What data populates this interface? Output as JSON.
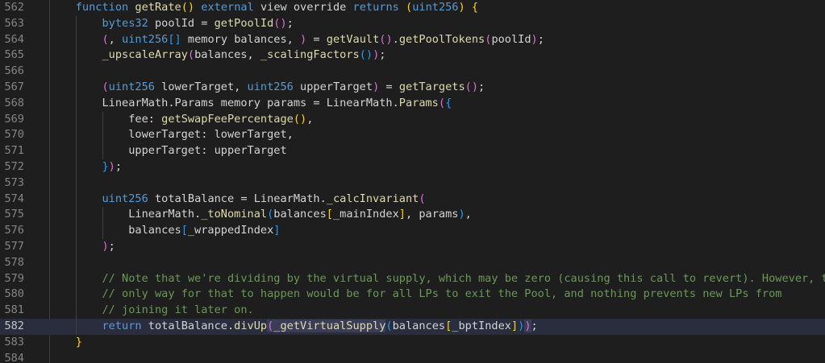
{
  "editor": {
    "lines": [
      {
        "num": "562",
        "tokens": [
          {
            "t": "    "
          },
          {
            "t": "function",
            "c": "kw"
          },
          {
            "t": " "
          },
          {
            "t": "getRate",
            "c": "fn"
          },
          {
            "t": "()",
            "c": "b1"
          },
          {
            "t": " "
          },
          {
            "t": "external",
            "c": "kw"
          },
          {
            "t": " view override "
          },
          {
            "t": "returns",
            "c": "kw"
          },
          {
            "t": " "
          },
          {
            "t": "(",
            "c": "b1"
          },
          {
            "t": "uint256",
            "c": "kw"
          },
          {
            "t": ")",
            "c": "b1"
          },
          {
            "t": " "
          },
          {
            "t": "{",
            "c": "b1"
          }
        ]
      },
      {
        "num": "563",
        "tokens": [
          {
            "t": "        "
          },
          {
            "t": "bytes32",
            "c": "kw"
          },
          {
            "t": " poolId = "
          },
          {
            "t": "getPoolId",
            "c": "fn"
          },
          {
            "t": "()",
            "c": "b2"
          },
          {
            "t": ";"
          }
        ]
      },
      {
        "num": "564",
        "tokens": [
          {
            "t": "        "
          },
          {
            "t": "(",
            "c": "b2"
          },
          {
            "t": ", "
          },
          {
            "t": "uint256",
            "c": "kw"
          },
          {
            "t": "[]",
            "c": "b3"
          },
          {
            "t": " memory balances, "
          },
          {
            "t": ")",
            "c": "b2"
          },
          {
            "t": " = "
          },
          {
            "t": "getVault",
            "c": "fn"
          },
          {
            "t": "()",
            "c": "b2"
          },
          {
            "t": "."
          },
          {
            "t": "getPoolTokens",
            "c": "fn"
          },
          {
            "t": "(",
            "c": "b2"
          },
          {
            "t": "poolId"
          },
          {
            "t": ")",
            "c": "b2"
          },
          {
            "t": ";"
          }
        ]
      },
      {
        "num": "565",
        "tokens": [
          {
            "t": "        "
          },
          {
            "t": "_upscaleArray",
            "c": "fn"
          },
          {
            "t": "(",
            "c": "b2"
          },
          {
            "t": "balances, "
          },
          {
            "t": "_scalingFactors",
            "c": "fn"
          },
          {
            "t": "()",
            "c": "b3"
          },
          {
            "t": ")",
            "c": "b2"
          },
          {
            "t": ";"
          }
        ]
      },
      {
        "num": "566",
        "tokens": []
      },
      {
        "num": "567",
        "tokens": [
          {
            "t": "        "
          },
          {
            "t": "(",
            "c": "b2"
          },
          {
            "t": "uint256",
            "c": "kw"
          },
          {
            "t": " lowerTarget, "
          },
          {
            "t": "uint256",
            "c": "kw"
          },
          {
            "t": " upperTarget"
          },
          {
            "t": ")",
            "c": "b2"
          },
          {
            "t": " = "
          },
          {
            "t": "getTargets",
            "c": "fn"
          },
          {
            "t": "()",
            "c": "b2"
          },
          {
            "t": ";"
          }
        ]
      },
      {
        "num": "568",
        "tokens": [
          {
            "t": "        LinearMath.Params memory params = LinearMath."
          },
          {
            "t": "Params",
            "c": "fn"
          },
          {
            "t": "(",
            "c": "b2"
          },
          {
            "t": "{",
            "c": "b3"
          }
        ]
      },
      {
        "num": "569",
        "tokens": [
          {
            "t": "            fee: "
          },
          {
            "t": "getSwapFeePercentage",
            "c": "fn"
          },
          {
            "t": "()",
            "c": "b1"
          },
          {
            "t": ","
          }
        ]
      },
      {
        "num": "570",
        "tokens": [
          {
            "t": "            lowerTarget: lowerTarget,"
          }
        ]
      },
      {
        "num": "571",
        "tokens": [
          {
            "t": "            upperTarget: upperTarget"
          }
        ]
      },
      {
        "num": "572",
        "tokens": [
          {
            "t": "        "
          },
          {
            "t": "}",
            "c": "b3"
          },
          {
            "t": ")",
            "c": "b2"
          },
          {
            "t": ";"
          }
        ]
      },
      {
        "num": "573",
        "tokens": []
      },
      {
        "num": "574",
        "tokens": [
          {
            "t": "        "
          },
          {
            "t": "uint256",
            "c": "kw"
          },
          {
            "t": " totalBalance = LinearMath."
          },
          {
            "t": "_calcInvariant",
            "c": "fn"
          },
          {
            "t": "(",
            "c": "b2"
          }
        ]
      },
      {
        "num": "575",
        "tokens": [
          {
            "t": "            LinearMath."
          },
          {
            "t": "_toNominal",
            "c": "fn"
          },
          {
            "t": "(",
            "c": "b3"
          },
          {
            "t": "balances"
          },
          {
            "t": "[",
            "c": "b1"
          },
          {
            "t": "_mainIndex"
          },
          {
            "t": "]",
            "c": "b1"
          },
          {
            "t": ", params"
          },
          {
            "t": ")",
            "c": "b3"
          },
          {
            "t": ","
          }
        ]
      },
      {
        "num": "576",
        "tokens": [
          {
            "t": "            balances"
          },
          {
            "t": "[",
            "c": "b3"
          },
          {
            "t": "_wrappedIndex"
          },
          {
            "t": "]",
            "c": "b3"
          }
        ]
      },
      {
        "num": "577",
        "tokens": [
          {
            "t": "        "
          },
          {
            "t": ")",
            "c": "b2"
          },
          {
            "t": ";"
          }
        ]
      },
      {
        "num": "578",
        "tokens": []
      },
      {
        "num": "579",
        "tokens": [
          {
            "t": "        "
          },
          {
            "t": "// Note that we're dividing by the virtual supply, which may be zero (causing this call to revert). However, the",
            "c": "cm"
          }
        ]
      },
      {
        "num": "580",
        "tokens": [
          {
            "t": "        "
          },
          {
            "t": "// only way for that to happen would be for all LPs to exit the Pool, and nothing prevents new LPs from",
            "c": "cm"
          }
        ]
      },
      {
        "num": "581",
        "tokens": [
          {
            "t": "        "
          },
          {
            "t": "// joining it later on.",
            "c": "cm"
          }
        ]
      },
      {
        "num": "582",
        "current": true,
        "tokens": [
          {
            "t": "        "
          },
          {
            "t": "return",
            "c": "kw"
          },
          {
            "t": " totalBalance."
          },
          {
            "t": "divUp",
            "c": "fn"
          },
          {
            "t": "(",
            "c": "b2 hl"
          },
          {
            "t": "_getVirtualSupply",
            "c": "fn hl"
          },
          {
            "t": "(",
            "c": "b3"
          },
          {
            "t": "balances"
          },
          {
            "t": "[",
            "c": "b1"
          },
          {
            "t": "_bptIndex"
          },
          {
            "t": "]",
            "c": "b1"
          },
          {
            "t": ")",
            "c": "b3"
          },
          {
            "t": ")",
            "c": "b2 hl"
          },
          {
            "t": ";"
          }
        ]
      },
      {
        "num": "583",
        "tokens": [
          {
            "t": "    "
          },
          {
            "t": "}",
            "c": "b1"
          }
        ]
      },
      {
        "num": "584",
        "tokens": []
      }
    ]
  }
}
